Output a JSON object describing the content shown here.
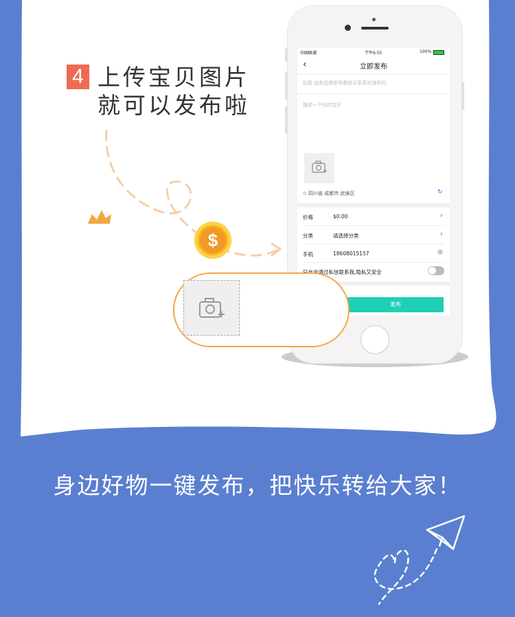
{
  "step": {
    "number": "4",
    "line1": "上传宝贝图片",
    "line2": "就可以发布啦"
  },
  "phone": {
    "status": {
      "carrier": "中国联通",
      "time": "下午6:55",
      "battery": "100%"
    },
    "nav": {
      "back_icon": "chevron-left-icon",
      "title": "立即发布"
    },
    "title_placeholder": "标题 品类品牌型号都是买家喜欢搜索的",
    "description_placeholder": "描述一下你的宝贝",
    "photo_icon": "camera-plus-icon",
    "location": "四川省 成都市 武侯区",
    "fields": [
      {
        "label": "价格",
        "value": "$0.00",
        "control": "chevron"
      },
      {
        "label": "分类",
        "value": "请选择分类",
        "control": "chevron"
      },
      {
        "label": "手机",
        "value": "18608015157",
        "control": "clear"
      }
    ],
    "private_option": "只允许通过私信联系我,隐私又安全",
    "publish_label": "发布"
  },
  "callout_icon": "camera-plus-icon",
  "coin_icon": "dollar-coin-icon",
  "slogan": "身边好物一键发布，把快乐转给大家！",
  "colors": {
    "background": "#5b7fd0",
    "badge": "#ee6b52",
    "accent_orange": "#f3a742",
    "publish_button": "#1fd0b5"
  }
}
